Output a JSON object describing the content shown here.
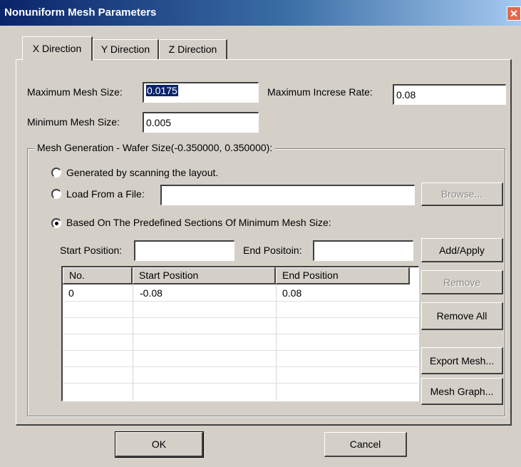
{
  "window": {
    "title": "Nonuniform Mesh Parameters",
    "close_glyph": "✕"
  },
  "tabs": [
    {
      "label": "X Direction",
      "active": true
    },
    {
      "label": "Y Direction",
      "active": false
    },
    {
      "label": "Z Direction",
      "active": false
    }
  ],
  "params": {
    "max_mesh_label": "Maximum Mesh Size:",
    "max_mesh_value": "0.0175",
    "max_rate_label": "Maximum Increse Rate:",
    "max_rate_value": "0.08",
    "min_mesh_label": "Minimum Mesh Size:",
    "min_mesh_value": "0.005"
  },
  "group": {
    "title": "Mesh Generation - Wafer Size(-0.350000, 0.350000):",
    "opt_scan": "Generated by scanning the layout.",
    "opt_load": "Load From a File:",
    "load_value": "",
    "browse_label": "Browse...",
    "opt_predef": "Based On The Predefined Sections Of Minimum Mesh Size:",
    "selected_option": "predefined",
    "start_label": "Start Position:",
    "start_value": "",
    "end_label": "End Positoin:",
    "end_value": "",
    "add_label": "Add/Apply",
    "remove_label": "Remove",
    "remove_all_label": "Remove All",
    "export_label": "Export Mesh...",
    "graph_label": "Mesh Graph..."
  },
  "table": {
    "headers": [
      "No.",
      "Start Position",
      "End Position"
    ],
    "rows": [
      [
        "0",
        "-0.08",
        "0.08"
      ]
    ]
  },
  "footer": {
    "ok_label": "OK",
    "cancel_label": "Cancel"
  }
}
